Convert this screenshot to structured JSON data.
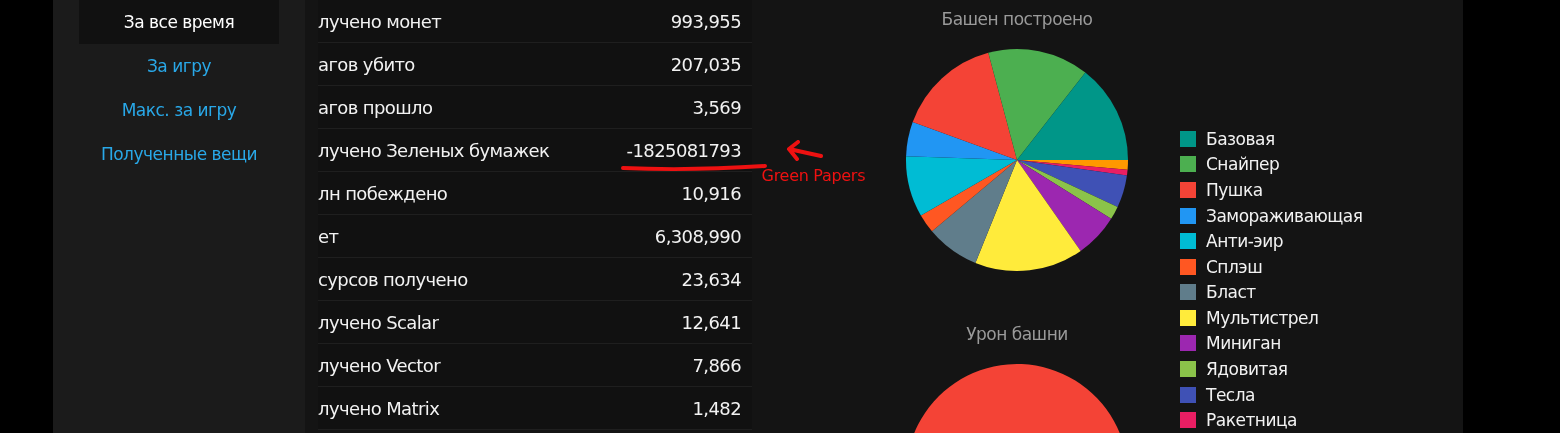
{
  "sidebar": {
    "items": [
      {
        "label": "За все время",
        "selected": true
      },
      {
        "label": "За игру",
        "selected": false
      },
      {
        "label": "Макс. за игру",
        "selected": false
      },
      {
        "label": "Полученные вещи",
        "selected": false
      }
    ]
  },
  "table": {
    "rows": [
      {
        "label": "лучено монет",
        "value": "993,955"
      },
      {
        "label": "агов убито",
        "value": "207,035"
      },
      {
        "label": "агов прошло",
        "value": "3,569"
      },
      {
        "label": "лучено Зеленых бумажек",
        "value": "-1825081793",
        "annotation": "Green Papers"
      },
      {
        "label": "лн побеждено",
        "value": "10,916"
      },
      {
        "label": "ет",
        "value": "6,308,990"
      },
      {
        "label": "сурсов получено",
        "value": "23,634"
      },
      {
        "label": "лучено Scalar",
        "value": "12,641"
      },
      {
        "label": "лучено Vector",
        "value": "7,866"
      },
      {
        "label": "лучено Matrix",
        "value": "1,482"
      }
    ]
  },
  "charts": [
    {
      "title": "Башен построено"
    },
    {
      "title": "Урон башни"
    }
  ],
  "legend": [
    {
      "label": "Базовая",
      "color": "#009688"
    },
    {
      "label": "Снайпер",
      "color": "#4caf50"
    },
    {
      "label": "Пушка",
      "color": "#f44336"
    },
    {
      "label": "Замораживающая",
      "color": "#2196f3"
    },
    {
      "label": "Анти-эир",
      "color": "#00bcd4"
    },
    {
      "label": "Сплэш",
      "color": "#ff5722"
    },
    {
      "label": "Бласт",
      "color": "#607d8b"
    },
    {
      "label": "Мультистрел",
      "color": "#ffeb3b"
    },
    {
      "label": "Миниган",
      "color": "#9c27b0"
    },
    {
      "label": "Ядовитая",
      "color": "#8bc34a"
    },
    {
      "label": "Тесла",
      "color": "#3f51b5"
    },
    {
      "label": "Ракетница",
      "color": "#e91e63"
    }
  ]
}
